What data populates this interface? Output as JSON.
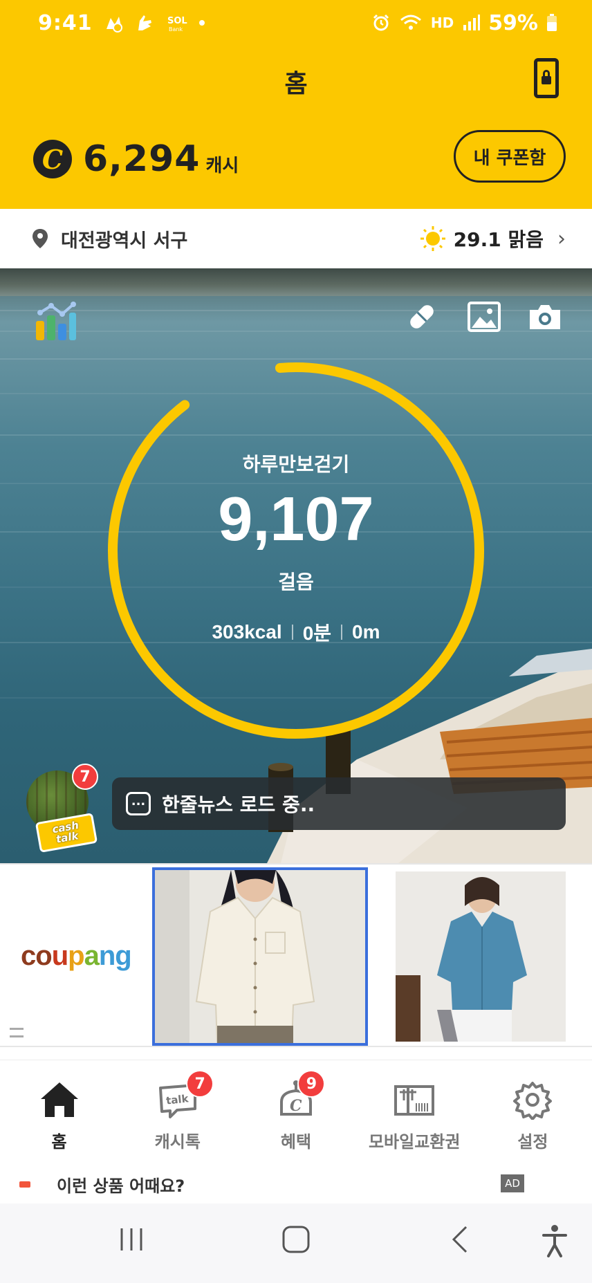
{
  "status_bar": {
    "time": "9:41",
    "left_icons": [
      "cash-notification-icon",
      "hand-notification-icon",
      "sol-bank-icon",
      "dot-icon"
    ],
    "right_icons": [
      "alarm-icon",
      "wifi-icon",
      "hd-voice-icon",
      "signal-icon",
      "battery-icon"
    ],
    "hd_label": "HD",
    "battery": "59%"
  },
  "header": {
    "title": "홈",
    "cash_amount": "6,294",
    "cash_unit": "캐시",
    "coupon_button": "내 쿠폰함"
  },
  "location": {
    "place": "대전광역시 서구",
    "weather": "29.1 맑음"
  },
  "pedometer": {
    "title": "하루만보걷기",
    "steps": "9,107",
    "unit": "걸음",
    "kcal": "303kcal",
    "minutes": "0분",
    "distance": "0m",
    "goal_progress": 0.91
  },
  "cashtalk": {
    "badge": "7",
    "label_line1": "cash",
    "label_line2": "talk",
    "news_icon": "...",
    "news_text": "한줄뉴스 로드 중.."
  },
  "ad_carousel": {
    "brand": [
      "co",
      "u",
      "p",
      "a",
      "ng"
    ]
  },
  "bottom_nav": {
    "items": [
      {
        "label": "홈",
        "icon": "home-icon"
      },
      {
        "label": "캐시톡",
        "icon": "talk-icon",
        "badge": "7"
      },
      {
        "label": "혜택",
        "icon": "benefit-icon",
        "badge": "9"
      },
      {
        "label": "모바일교환권",
        "icon": "gift-card-icon"
      },
      {
        "label": "설정",
        "icon": "settings-icon"
      }
    ],
    "talk_glyph": "talk",
    "coin_glyph": "C"
  },
  "suggestion": {
    "text": "이런 상품 어때요?",
    "ad_label": "AD"
  },
  "colors": {
    "brand_yellow": "#fcc800",
    "badge_red": "#f23d3d",
    "selection_blue": "#3b6fdc"
  }
}
